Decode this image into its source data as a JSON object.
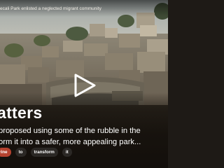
{
  "video": {
    "top_caption": "ecali Park enlisted a neglected migrant community",
    "headline": "atters",
    "subtitle_lines": [
      "proposed using some of the rubble in the",
      "orm it into a safer, more appealing park..."
    ],
    "tags": [
      "rine",
      "to",
      "transform",
      "it"
    ],
    "play_icon": "play-icon",
    "accent_color": "#b5422f"
  }
}
